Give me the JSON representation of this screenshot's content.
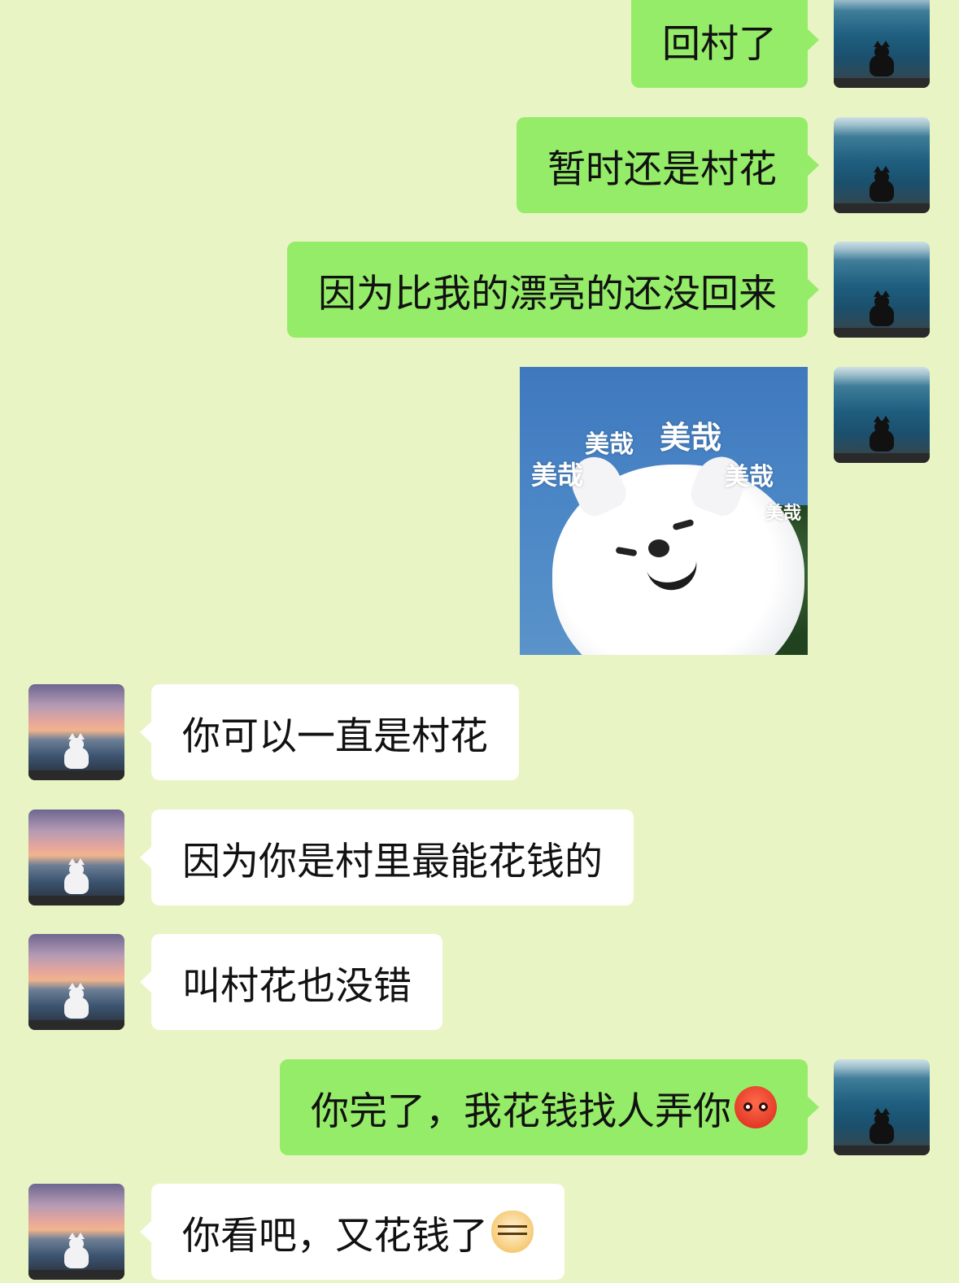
{
  "messages": [
    {
      "side": "me",
      "text": "回村了"
    },
    {
      "side": "me",
      "text": "暂时还是村花"
    },
    {
      "side": "me",
      "text": "因为比我的漂亮的还没回来"
    },
    {
      "side": "me",
      "type": "sticker",
      "labels": [
        "美哉",
        "美哉",
        "美哉",
        "美哉",
        "美哉"
      ]
    },
    {
      "side": "them",
      "text": "你可以一直是村花"
    },
    {
      "side": "them",
      "text": "因为你是村里最能花钱的"
    },
    {
      "side": "them",
      "text": "叫村花也没错"
    },
    {
      "side": "me",
      "text": "你完了，我花钱找人弄你",
      "emoji": "angry-face"
    },
    {
      "side": "them",
      "text": "你看吧，又花钱了",
      "emoji": "doge-face"
    }
  ],
  "colors": {
    "background": "#e9f4c4",
    "my_bubble": "#95ec69",
    "their_bubble": "#ffffff"
  }
}
